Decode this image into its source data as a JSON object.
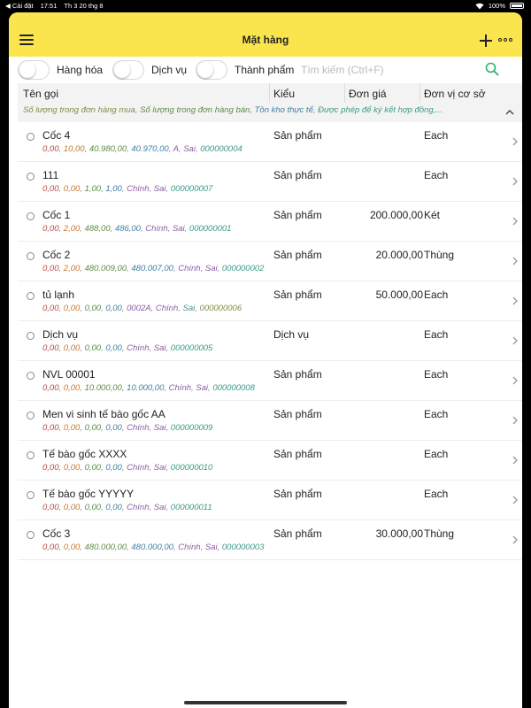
{
  "status_bar": {
    "back_app": "◀ Cài đặt",
    "time": "17:51",
    "date": "Th 3 20 thg 8",
    "battery": "100%"
  },
  "header": {
    "title": "Mặt hàng"
  },
  "filters": {
    "goods_label": "Hàng hóa",
    "service_label": "Dịch vụ",
    "finished_label": "Thành phẩm",
    "search_placeholder": "Tìm kiếm (Ctrl+F)"
  },
  "columns": {
    "name": "Tên gọi",
    "kind": "Kiểu",
    "price": "Đơn giá",
    "base_unit": "Đơn vị cơ sở",
    "sub": [
      "Số lượng trong đơn hàng mua",
      "Số lượng trong đơn hàng bán",
      "Tồn kho thực tế",
      "Được phép để ký kết hợp đồng,..."
    ]
  },
  "items": [
    {
      "name": "Cốc 4",
      "kind": "Sản phẩm",
      "price": "",
      "unit": "Each",
      "sub": [
        "0,00",
        "10,00",
        "40.980,00",
        "40.970,00",
        "A",
        "Sai",
        "000000004"
      ]
    },
    {
      "name": "111",
      "kind": "Sản phẩm",
      "price": "",
      "unit": "Each",
      "sub": [
        "0,00",
        "0,00",
        "1,00",
        "1,00",
        "Chính",
        "Sai",
        "000000007"
      ]
    },
    {
      "name": "Cốc 1",
      "kind": "Sản phẩm",
      "price": "200.000,00",
      "unit": "Két",
      "sub": [
        "0,00",
        "2,00",
        "488,00",
        "486,00",
        "Chính",
        "Sai",
        "000000001"
      ]
    },
    {
      "name": "Cốc 2",
      "kind": "Sản phẩm",
      "price": "20.000,00",
      "unit": "Thùng",
      "sub": [
        "0,00",
        "2,00",
        "480.009,00",
        "480.007,00",
        "Chính",
        "Sai",
        "000000002"
      ]
    },
    {
      "name": "tủ lạnh",
      "kind": "Sản phẩm",
      "price": "50.000,00",
      "unit": "Each",
      "sub": [
        "0,00",
        "0,00",
        "0,00",
        "0,00",
        "0002A",
        "Chính",
        "Sai",
        "000000006"
      ]
    },
    {
      "name": "Dịch vụ",
      "kind": "Dịch vụ",
      "price": "",
      "unit": "Each",
      "sub": [
        "0,00",
        "0,00",
        "0,00",
        "0,00",
        "Chính",
        "Sai",
        "000000005"
      ]
    },
    {
      "name": "NVL 00001",
      "kind": "Sản phẩm",
      "price": "",
      "unit": "Each",
      "sub": [
        "0,00",
        "0,00",
        "10.000,00",
        "10.000,00",
        "Chính",
        "Sai",
        "000000008"
      ]
    },
    {
      "name": "Men vi sinh tế bào gốc AA",
      "kind": "Sản phẩm",
      "price": "",
      "unit": "Each",
      "sub": [
        "0,00",
        "0,00",
        "0,00",
        "0,00",
        "Chính",
        "Sai",
        "000000009"
      ]
    },
    {
      "name": "Tế bào gốc XXXX",
      "kind": "Sản phẩm",
      "price": "",
      "unit": "Each",
      "sub": [
        "0,00",
        "0,00",
        "0,00",
        "0,00",
        "Chính",
        "Sai",
        "000000010"
      ]
    },
    {
      "name": "Tế bào gốc YYYYY",
      "kind": "Sản phẩm",
      "price": "",
      "unit": "Each",
      "sub": [
        "0,00",
        "0,00",
        "0,00",
        "0,00",
        "Chính",
        "Sai",
        "000000011"
      ]
    },
    {
      "name": "Cốc 3",
      "kind": "Sản phẩm",
      "price": "30.000,00",
      "unit": "Thùng",
      "sub": [
        "0,00",
        "0,00",
        "480.000,00",
        "480.000,00",
        "Chính",
        "Sai",
        "000000003"
      ]
    }
  ],
  "colors": {
    "accent": "#fbe54e",
    "search_icon": "#2bb36b"
  }
}
